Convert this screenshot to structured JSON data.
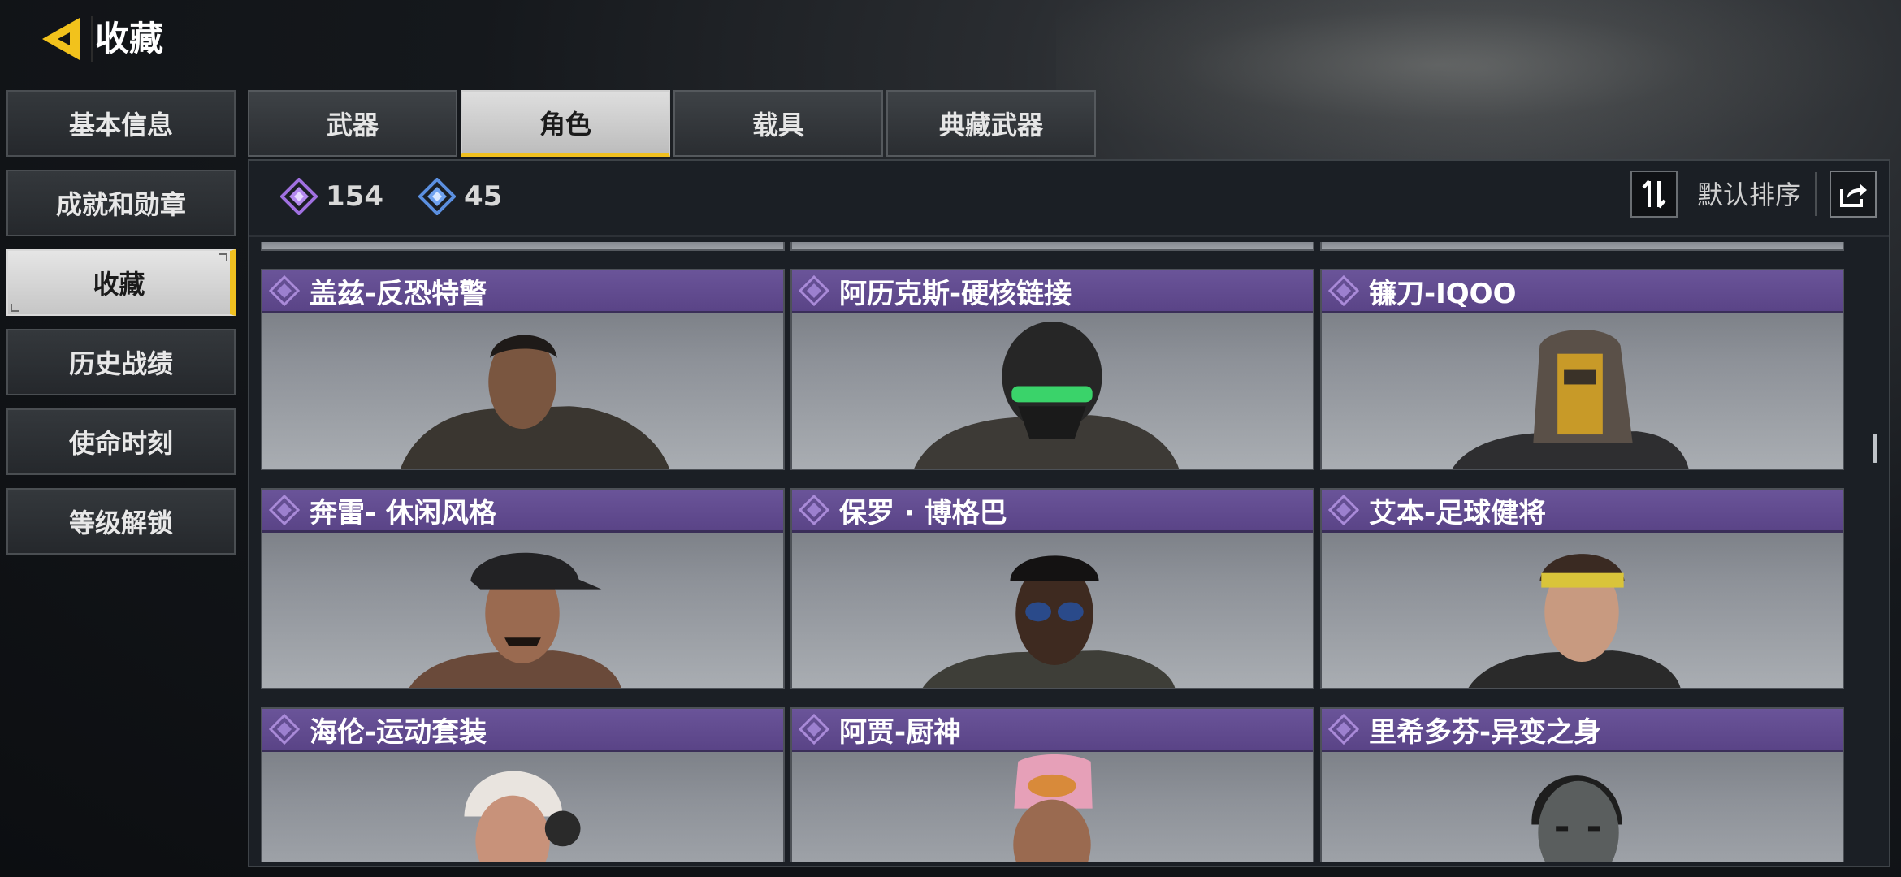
{
  "header": {
    "title": "收藏",
    "back_icon": "chevron-left-icon"
  },
  "sidebar": {
    "items": [
      {
        "label": "基本信息",
        "active": false
      },
      {
        "label": "成就和勋章",
        "active": false
      },
      {
        "label": "收藏",
        "active": true
      },
      {
        "label": "历史战绩",
        "active": false
      },
      {
        "label": "使命时刻",
        "active": false
      },
      {
        "label": "等级解锁",
        "active": false
      }
    ]
  },
  "tabs": [
    {
      "label": "武器",
      "active": false
    },
    {
      "label": "角色",
      "active": true
    },
    {
      "label": "载具",
      "active": false
    },
    {
      "label": "典藏武器",
      "active": false
    }
  ],
  "toolbar": {
    "currency_purple": {
      "icon": "purple-diamond-icon",
      "value": "154"
    },
    "currency_blue": {
      "icon": "blue-diamond-icon",
      "value": "45"
    },
    "sort_icon": "sort-arrows-icon",
    "sort_label": "默认排序",
    "share_icon": "share-icon"
  },
  "characters": [
    {
      "name": "盖兹-反恐特警",
      "portrait": "male-soldier-portrait"
    },
    {
      "name": "阿历克斯-硬核链接",
      "portrait": "masked-soldier-green-goggles-portrait"
    },
    {
      "name": "镰刀-IQOO",
      "portrait": "gold-robot-portrait"
    },
    {
      "name": "奔雷- 休闲风格",
      "portrait": "cap-mustache-portrait"
    },
    {
      "name": "保罗 · 博格巴",
      "portrait": "sunglasses-portrait"
    },
    {
      "name": "艾本-足球健将",
      "portrait": "headband-woman-portrait"
    },
    {
      "name": "海伦-运动套装",
      "portrait": "headphones-woman-portrait"
    },
    {
      "name": "阿贾-厨神",
      "portrait": "chef-hat-portrait"
    },
    {
      "name": "里希多芬-异变之身",
      "portrait": "zombie-portrait"
    }
  ],
  "colors": {
    "accent": "#f0c020",
    "card_title_bg": "#5e4a8c",
    "currency_purple": "#a070e0",
    "currency_blue": "#5b8fe0"
  }
}
